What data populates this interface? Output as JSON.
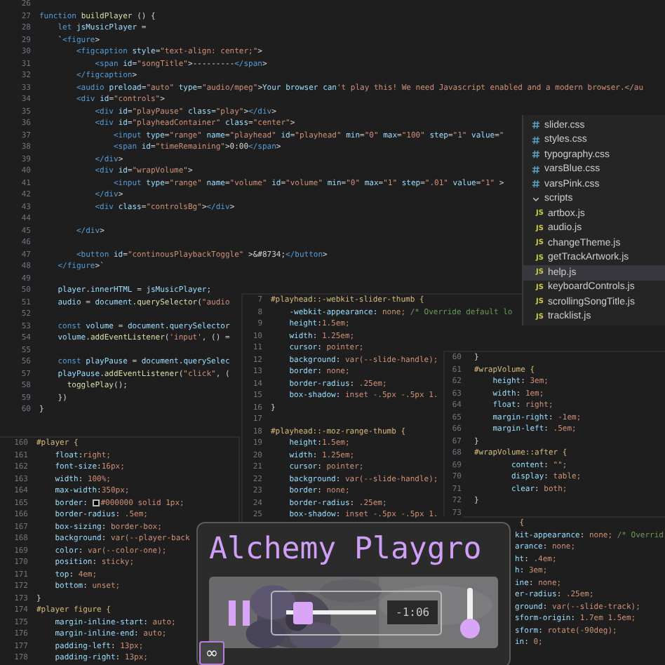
{
  "editors": [
    {
      "kind": "js",
      "lines": [
        {
          "num": "26"
        },
        {
          "num": "27",
          "text": "function buildPlayer () {"
        },
        {
          "num": "28",
          "text": "    let jsMusicPlayer ="
        },
        {
          "num": "29",
          "text": "    `<figure>"
        },
        {
          "num": "30",
          "text": "        <figcaption style=\"text-align: center;\">"
        },
        {
          "num": "31",
          "text": "            <span id=\"songTitle\">---------</span>"
        },
        {
          "num": "32",
          "text": "        </figcaption>"
        },
        {
          "num": "33",
          "text": "        <audio preload=\"auto\" type=\"audio/mpeg\">Your browser can't play this! We need Javascript enabled and a modern browser.</au"
        },
        {
          "num": "34",
          "text": "        <div id=\"controls\">"
        },
        {
          "num": "35",
          "text": "            <div id=\"playPause\" class=\"play\"></div>"
        },
        {
          "num": "36",
          "text": "            <div id=\"playheadContainer\" class=\"center\">"
        },
        {
          "num": "37",
          "text": "                <input type=\"range\" name=\"playhead\" id=\"playhead\" min=\"0\" max=\"100\" step=\"1\" value=\""
        },
        {
          "num": "38",
          "text": "                <span id=\"timeRemaining\">0:00</span>"
        },
        {
          "num": "39",
          "text": "            </div>"
        },
        {
          "num": "40",
          "text": "            <div id=\"wrapVolume\">"
        },
        {
          "num": "41",
          "text": "                <input type=\"range\" name=\"volume\" id=\"volume\" min=\"0\" max=\"1\" step=\".01\" value=\"1\" >"
        },
        {
          "num": "42",
          "text": "            </div>"
        },
        {
          "num": "43",
          "text": "            <div class=\"controlsBg\"></div>"
        },
        {
          "num": "44"
        },
        {
          "num": "45",
          "text": "        </div>"
        },
        {
          "num": "46"
        },
        {
          "num": "47",
          "text": "        <button id=\"continousPlaybackToggle\" >&#8734;</button>"
        },
        {
          "num": "48",
          "text": "    </figure>`"
        },
        {
          "num": "49"
        },
        {
          "num": "50",
          "text": "    player.innerHTML = jsMusicPlayer;"
        },
        {
          "num": "51",
          "text": "    audio = document.querySelector(\"audio"
        },
        {
          "num": "52"
        },
        {
          "num": "53",
          "text": "    const volume = document.querySelector"
        },
        {
          "num": "54",
          "text": "    volume.addEventListener('input', () ="
        },
        {
          "num": "55"
        },
        {
          "num": "56",
          "text": "    const playPause = document.querySelec"
        },
        {
          "num": "57",
          "text": "    playPause.addEventListener(\"click\", ("
        },
        {
          "num": "58",
          "text": "      togglePlay();"
        },
        {
          "num": "59",
          "text": "    })"
        },
        {
          "num": "60",
          "text": "}"
        }
      ]
    },
    {
      "kind": "css",
      "lines": [
        {
          "num": "7",
          "text": "#playhead::-webkit-slider-thumb {"
        },
        {
          "num": "8",
          "text": "    -webkit-appearance: none; /* Override default lo"
        },
        {
          "num": "9",
          "text": "    height:1.5em;"
        },
        {
          "num": "10",
          "text": "    width: 1.25em;"
        },
        {
          "num": "11",
          "text": "    cursor: pointer;"
        },
        {
          "num": "12",
          "text": "    background: var(--slide-handle);"
        },
        {
          "num": "13",
          "text": "    border: none;"
        },
        {
          "num": "14",
          "text": "    border-radius: .25em;"
        },
        {
          "num": "15",
          "text": "    box-shadow: inset -.5px -.5px 1."
        },
        {
          "num": "16",
          "text": "}"
        },
        {
          "num": "17"
        },
        {
          "num": "18",
          "text": "#playhead::-moz-range-thumb {"
        },
        {
          "num": "19",
          "text": "    height:1.5em;"
        },
        {
          "num": "20",
          "text": "    width: 1.25em;"
        },
        {
          "num": "21",
          "text": "    cursor: pointer;"
        },
        {
          "num": "22",
          "text": "    background: var(--slide-handle);"
        },
        {
          "num": "23",
          "text": "    border: none;"
        },
        {
          "num": "24",
          "text": "    border-radius: .25em;"
        },
        {
          "num": "25",
          "text": "    box-shadow: inset -.5px -.5px 1."
        }
      ]
    },
    {
      "kind": "css",
      "lines": [
        {
          "num": "60",
          "text": "}"
        },
        {
          "num": "61",
          "text": "#wrapVolume {"
        },
        {
          "num": "62",
          "text": "    height: 3em;"
        },
        {
          "num": "63",
          "text": "    width: 1em;"
        },
        {
          "num": "64",
          "text": "    float: right;"
        },
        {
          "num": "65",
          "text": "    margin-right: -1em;"
        },
        {
          "num": "66",
          "text": "    margin-left: .5em;"
        },
        {
          "num": "67",
          "text": "}"
        },
        {
          "num": "68",
          "text": "#wrapVolume::after {"
        },
        {
          "num": "69",
          "text": "        content: \"\";"
        },
        {
          "num": "70",
          "text": "        display: table;"
        },
        {
          "num": "71",
          "text": "        clear: both;"
        },
        {
          "num": "72",
          "text": "}"
        },
        {
          "num": "73"
        }
      ]
    },
    {
      "kind": "css",
      "lines": [
        {
          "num": "160",
          "text": "#player {"
        },
        {
          "num": "161",
          "text": "    float:right;"
        },
        {
          "num": "162",
          "text": "    font-size:16px;"
        },
        {
          "num": "163",
          "text": "    width: 100%;"
        },
        {
          "num": "164",
          "text": "    max-width:350px;"
        },
        {
          "num": "165",
          "text": "    border: ",
          "swatch": true,
          "after": "#000000 solid 1px;"
        },
        {
          "num": "166",
          "text": "    border-radius: .5em;"
        },
        {
          "num": "167",
          "text": "    box-sizing: border-box;"
        },
        {
          "num": "168",
          "text": "    background: var(--player-back"
        },
        {
          "num": "169",
          "text": "    color: var(--color-one);"
        },
        {
          "num": "170",
          "text": "    position: sticky;"
        },
        {
          "num": "171",
          "text": "    top: 4em;"
        },
        {
          "num": "172",
          "text": "    bottom: unset;"
        },
        {
          "num": "173",
          "text": "}"
        },
        {
          "num": "174",
          "text": "#player figure {"
        },
        {
          "num": "175",
          "text": "    margin-inline-start: auto;"
        },
        {
          "num": "176",
          "text": "    margin-inline-end: auto;"
        },
        {
          "num": "177",
          "text": "    padding-left: 13px;"
        },
        {
          "num": "178",
          "text": "    padding-right: 13px;"
        }
      ]
    },
    {
      "kind": "css",
      "lines": [
        {
          "text": " {"
        },
        {
          "text": "kit-appearance: none; /* Overrid"
        },
        {
          "text": "arance: none;"
        },
        {
          "text": "ht: .4em;"
        },
        {
          "text": "h: 3em;"
        },
        {
          "text": "ine: none;"
        },
        {
          "text": "er-radius: .25em;"
        },
        {
          "text": "ground: var(--slide-track);"
        },
        {
          "text": "sform-origin: 1.7em 1.5em;"
        },
        {
          "text": "sform: rotate(-90deg);"
        },
        {
          "text": "in: 0;"
        }
      ]
    }
  ],
  "explorer": {
    "items": [
      {
        "kind": "css",
        "label": "slider.css",
        "selected": false
      },
      {
        "kind": "css",
        "label": "styles.css",
        "selected": false
      },
      {
        "kind": "css",
        "label": "typography.css",
        "selected": false
      },
      {
        "kind": "css",
        "label": "varsBlue.css",
        "selected": false
      },
      {
        "kind": "css",
        "label": "varsPink.css",
        "selected": false
      },
      {
        "kind": "folder",
        "label": "scripts",
        "expanded": true,
        "selected": false,
        "children": [
          {
            "kind": "js",
            "badge": "JS",
            "label": "artbox.js",
            "selected": false
          },
          {
            "kind": "js",
            "badge": "JS",
            "label": "audio.js",
            "selected": false
          },
          {
            "kind": "js",
            "badge": "JS",
            "label": "changeTheme.js",
            "selected": false
          },
          {
            "kind": "js",
            "badge": "JS",
            "label": "getTrackArtwork.js",
            "selected": false
          },
          {
            "kind": "js",
            "badge": "JS",
            "label": "help.js",
            "selected": true
          },
          {
            "kind": "js",
            "badge": "JS",
            "label": "keyboardControls.js",
            "selected": false
          },
          {
            "kind": "js",
            "badge": "JS",
            "label": "scrollingSongTitle.js",
            "selected": false
          },
          {
            "kind": "js",
            "badge": "JS",
            "label": "tracklist.js",
            "selected": false
          }
        ]
      }
    ]
  },
  "player": {
    "title": "Alchemy Playgro",
    "playing": true,
    "playhead": {
      "level": 0.1
    },
    "time": "-1:06",
    "loop_button": "∞"
  }
}
